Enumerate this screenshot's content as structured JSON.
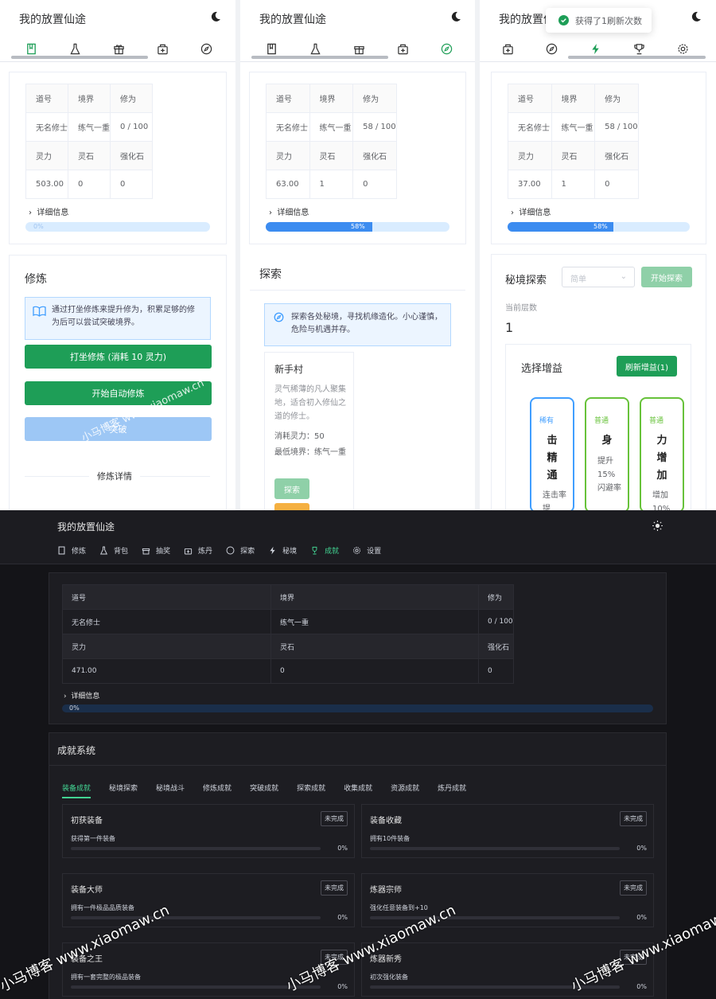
{
  "app_title": "我的放置仙途",
  "stats_headers_1": [
    "道号",
    "境界",
    "修为"
  ],
  "stats_headers_2": [
    "灵力",
    "灵石",
    "强化石"
  ],
  "panel1": {
    "name": "无名修士",
    "realm": "练气一重",
    "cult": "0 / 100",
    "spirit": "503.00",
    "stones": "0",
    "refine": "0",
    "progress": "0%",
    "progress_value": 0
  },
  "panel2": {
    "name": "无名修士",
    "realm": "练气一重",
    "cult": "58 / 100",
    "spirit": "63.00",
    "stones": "1",
    "refine": "0",
    "progress": "58%",
    "progress_value": 58
  },
  "panel3": {
    "name": "无名修士",
    "realm": "练气一重",
    "cult": "58 / 100",
    "spirit": "37.00",
    "stones": "1",
    "refine": "0",
    "progress": "58%",
    "progress_value": 58
  },
  "detail_info": "详细信息",
  "cultivate": {
    "title": "修炼",
    "info": "通过打坐修炼来提升修为，积累足够的修为后可以尝试突破境界。",
    "btn_meditate": "打坐修炼 (消耗 10 灵力)",
    "btn_auto": "开始自动修炼",
    "btn_break": "突破",
    "details": "修炼详情"
  },
  "explore": {
    "title": "探索",
    "info": "探索各处秘境，寻找机缘造化。小心谨慎，危险与机遇并存。",
    "place": "新手村",
    "desc": "灵气稀薄的凡人聚集地，适合初入修仙之道的修士。",
    "cost": "消耗灵力：50",
    "min": "最低境界：练气一重",
    "btn": "探索"
  },
  "secret": {
    "title": "秘境探索",
    "difficulty": "简单",
    "start": "开始探索",
    "floor_label": "当前层数",
    "floor": "1",
    "buff_title": "选择增益",
    "refresh": "刷新增益(1)",
    "buffs": [
      {
        "q": "稀有",
        "n": "击精通",
        "s": "连击率提"
      },
      {
        "q": "普通",
        "n": "身",
        "s": "提升15%闪避率"
      },
      {
        "q": "普通",
        "n": "力增加",
        "s": "增加10%"
      }
    ]
  },
  "toast": "获得了1刷新次数",
  "dark": {
    "title": "我的放置仙途",
    "nav": [
      "修炼",
      "背包",
      "抽奖",
      "炼丹",
      "探索",
      "秘境",
      "成就",
      "设置"
    ],
    "name": "无名修士",
    "realm": "练气一重",
    "cult": "0 / 100",
    "spirit": "471.00",
    "stones": "0",
    "refine": "0",
    "progress": "0%",
    "progress_value": 0,
    "ach_title": "成就系统",
    "tabs": [
      "装备成就",
      "秘境探索",
      "秘境战斗",
      "修炼成就",
      "突破成就",
      "探索成就",
      "收集成就",
      "资源成就",
      "炼丹成就"
    ],
    "achievements": [
      {
        "t": "初获装备",
        "d": "获得第一件装备",
        "b": "未完成",
        "p": "0%"
      },
      {
        "t": "装备收藏",
        "d": "拥有10件装备",
        "b": "未完成",
        "p": "0%"
      },
      {
        "t": "装备大师",
        "d": "拥有一件极品品质装备",
        "b": "未完成",
        "p": "0%"
      },
      {
        "t": "炼器宗师",
        "d": "强化任意装备到+10",
        "b": "未完成",
        "p": "0%"
      },
      {
        "t": "装备之王",
        "d": "拥有一套完整的极品装备",
        "b": "未完成",
        "p": "0%"
      },
      {
        "t": "炼器新秀",
        "d": "初次强化装备",
        "b": "未完成",
        "p": "0%"
      }
    ]
  },
  "watermark": "小马博客 www.xiaomaw.cn",
  "colors": {
    "accent": "#1e9e57",
    "dark_accent": "#42d392",
    "progress": "#3c8cf0"
  }
}
